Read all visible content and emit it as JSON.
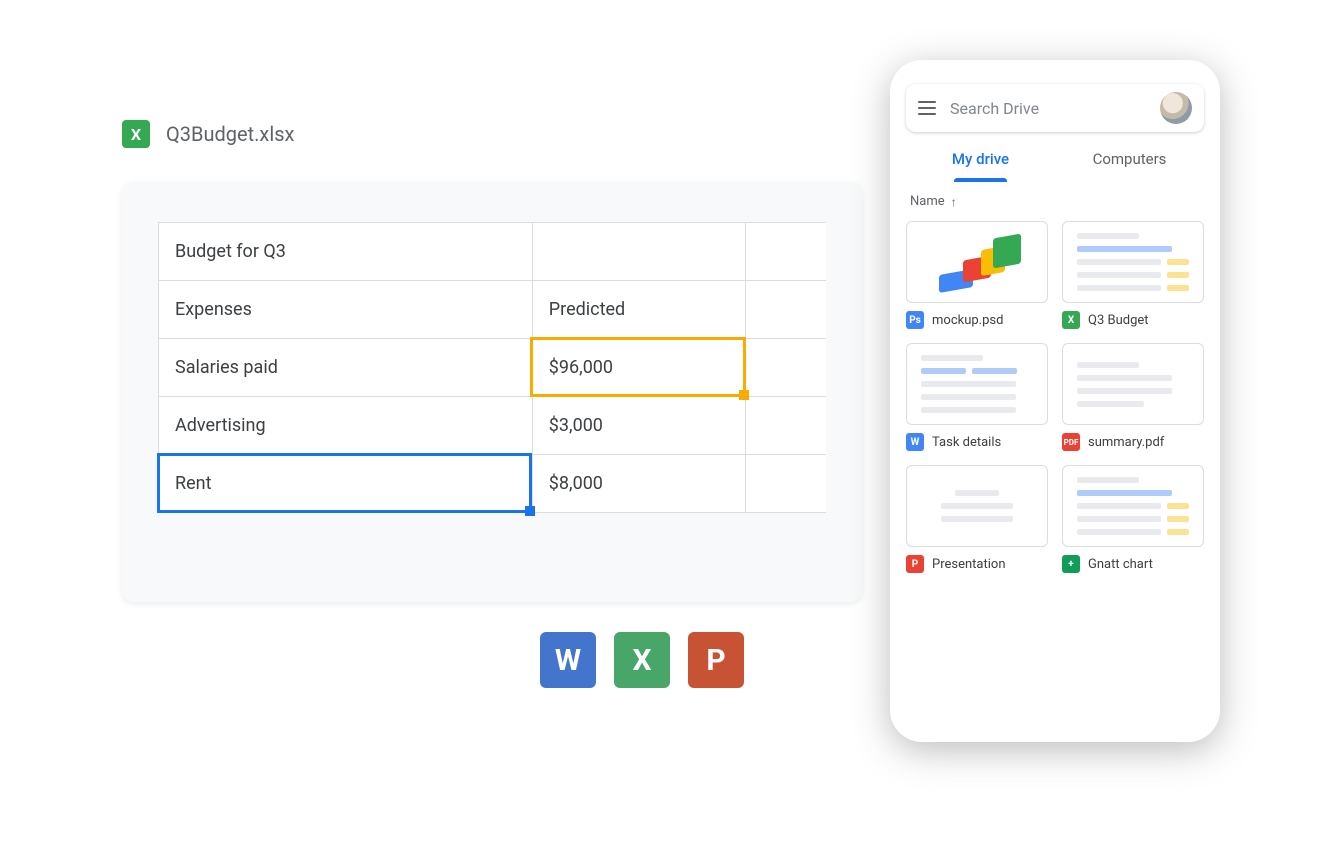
{
  "file": {
    "icon_letter": "X",
    "name": "Q3Budget.xlsx"
  },
  "sheet": {
    "rows": [
      [
        "Budget for Q3",
        "",
        ""
      ],
      [
        "Expenses",
        "Predicted",
        ""
      ],
      [
        "Salaries paid",
        "$96,000",
        ""
      ],
      [
        "Advertising",
        "$3,000",
        ""
      ],
      [
        "Rent",
        "$8,000",
        ""
      ]
    ],
    "selection_yellow": {
      "row": 2,
      "col": 1
    },
    "selection_blue": {
      "row": 4,
      "col": 0
    }
  },
  "app_icons": {
    "word": "W",
    "excel": "X",
    "ppt": "P"
  },
  "drive": {
    "search_placeholder": "Search Drive",
    "tabs": {
      "my_drive": "My drive",
      "computers": "Computers"
    },
    "sort": {
      "label": "Name",
      "dir": "↑"
    },
    "files": [
      {
        "icon": "Ps",
        "icon_class": "ic-ps",
        "label": "mockup.psd",
        "thumb": "blocks"
      },
      {
        "icon": "X",
        "icon_class": "ic-xl",
        "label": "Q3 Budget",
        "thumb": "spreadsheet"
      },
      {
        "icon": "W",
        "icon_class": "ic-wd",
        "label": "Task details",
        "thumb": "doc-blue"
      },
      {
        "icon": "PDF",
        "icon_class": "ic-pdf",
        "label": "summary.pdf",
        "thumb": "doc-plain"
      },
      {
        "icon": "P",
        "icon_class": "ic-pp",
        "label": "Presentation",
        "thumb": "doc-center"
      },
      {
        "icon": "+",
        "icon_class": "ic-sheets",
        "label": "Gnatt chart",
        "thumb": "spreadsheet"
      }
    ]
  }
}
